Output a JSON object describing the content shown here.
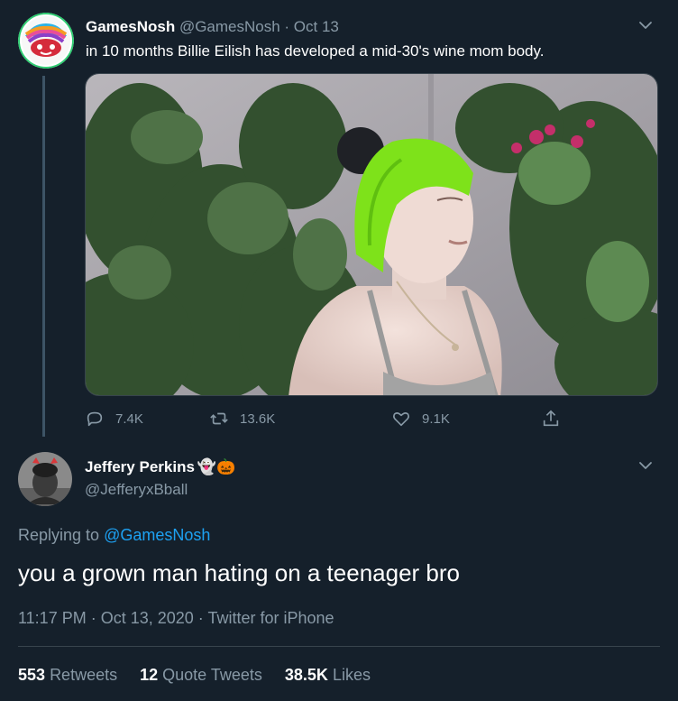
{
  "original_tweet": {
    "display_name": "GamesNosh",
    "handle": "@GamesNosh",
    "separator": " · ",
    "date": "Oct 13",
    "text": "in 10 months Billie Eilish has developed a mid-30's wine mom body.",
    "avatar_icon": "games-nosh-logo-icon",
    "media_description_icon": "photo-icon",
    "actions": {
      "replies": "7.4K",
      "retweets": "13.6K",
      "likes": "9.1K"
    }
  },
  "reply_tweet": {
    "display_name": "Jeffery Perkins",
    "emoji": "👻🎃",
    "handle": "@JefferyxBball",
    "replying_prefix": "Replying to ",
    "replying_to": "@GamesNosh",
    "text": "you a grown man hating on a teenager bro",
    "timestamp": "11:17 PM · Oct 13, 2020 · Twitter for iPhone",
    "stats": {
      "retweets_count": "553",
      "retweets_label": "Retweets",
      "quote_count": "12",
      "quote_label": "Quote Tweets",
      "likes_count": "38.5K",
      "likes_label": "Likes"
    }
  },
  "colors": {
    "background": "#15202b",
    "secondary_text": "#8899a6",
    "link": "#1da1f2",
    "divider": "#38444d"
  }
}
